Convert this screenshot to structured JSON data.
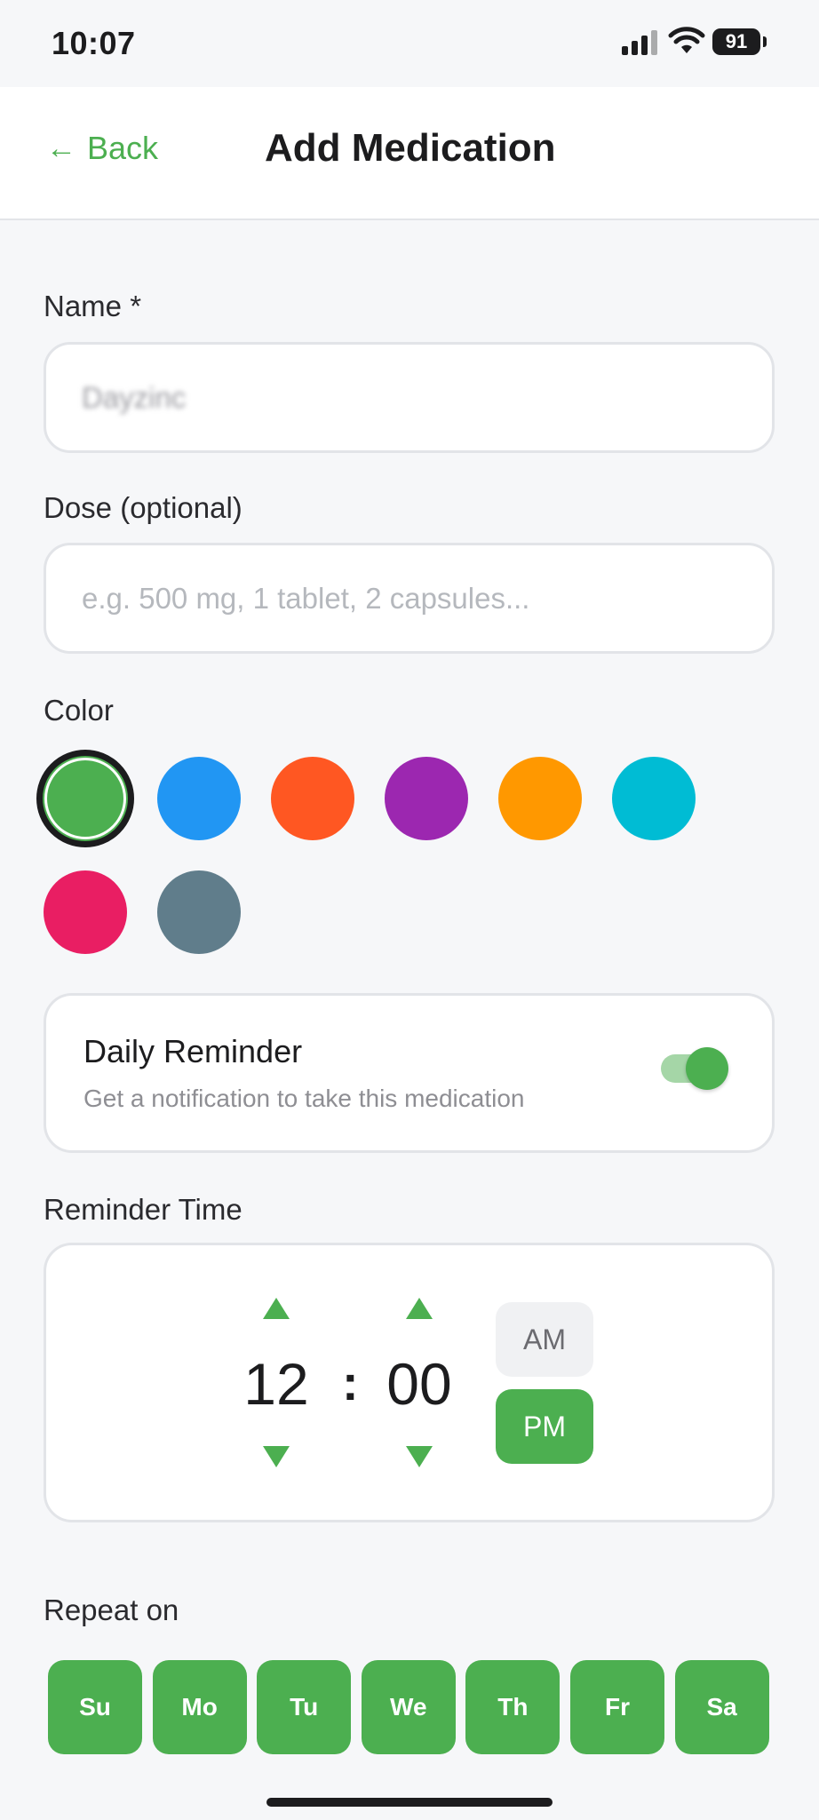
{
  "status_bar": {
    "time": "10:07",
    "battery": "91"
  },
  "nav": {
    "back_arrow": "←",
    "back_label": "Back",
    "title": "Add Medication"
  },
  "name_field": {
    "label": "Name *",
    "value": "Dayzinc"
  },
  "dose_field": {
    "label": "Dose (optional)",
    "placeholder": "e.g. 500 mg, 1 tablet, 2 capsules..."
  },
  "color_section": {
    "label": "Color",
    "swatches": [
      "#4caf50",
      "#2196f3",
      "#ff5722",
      "#9c27b0",
      "#ff9800",
      "#00bcd4",
      "#e91e63",
      "#607d8b"
    ],
    "selected_index": 0
  },
  "daily_reminder": {
    "title": "Daily Reminder",
    "subtitle": "Get a notification to take this medication",
    "enabled": true
  },
  "reminder_time": {
    "label": "Reminder Time",
    "hour": "12",
    "separator": ":",
    "minute": "00",
    "am_label": "AM",
    "pm_label": "PM",
    "selected_period": "PM"
  },
  "repeat": {
    "label": "Repeat on",
    "days": [
      "Su",
      "Mo",
      "Tu",
      "We",
      "Th",
      "Fr",
      "Sa"
    ]
  },
  "colors": {
    "accent": "#4caf50",
    "accent_light": "#a5d6a7"
  }
}
